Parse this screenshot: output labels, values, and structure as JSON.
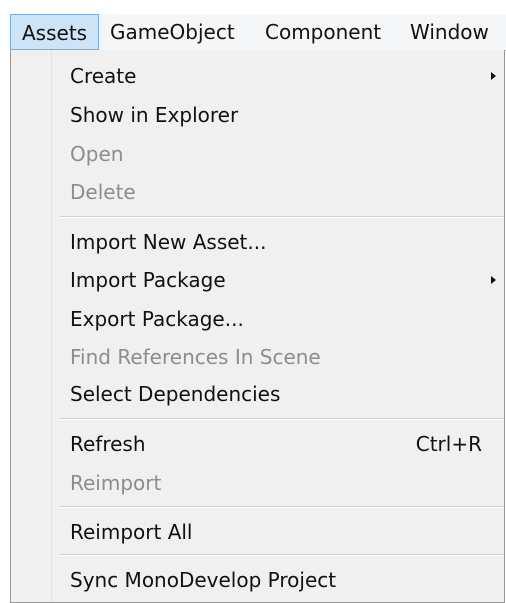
{
  "menubar": {
    "items": [
      "Assets",
      "GameObject",
      "Component",
      "Window"
    ],
    "active": "Assets"
  },
  "menu": {
    "items": [
      {
        "label": "Create",
        "enabled": true,
        "submenu": true
      },
      {
        "label": "Show in Explorer",
        "enabled": true
      },
      {
        "label": "Open",
        "enabled": false
      },
      {
        "label": "Delete",
        "enabled": false
      },
      {
        "label": "Import New Asset...",
        "enabled": true
      },
      {
        "label": "Import Package",
        "enabled": true,
        "submenu": true
      },
      {
        "label": "Export Package...",
        "enabled": true
      },
      {
        "label": "Find References In Scene",
        "enabled": false
      },
      {
        "label": "Select Dependencies",
        "enabled": true
      },
      {
        "label": "Refresh",
        "enabled": true,
        "shortcut": "Ctrl+R"
      },
      {
        "label": "Reimport",
        "enabled": false
      },
      {
        "label": "Reimport All",
        "enabled": true
      },
      {
        "label": "Sync MonoDevelop Project",
        "enabled": true
      }
    ]
  },
  "colors": {
    "active_highlight": "#cde4f7",
    "active_border": "#78aedc",
    "menu_background": "#f0f0f0",
    "disabled_text": "#8d8d8d"
  }
}
